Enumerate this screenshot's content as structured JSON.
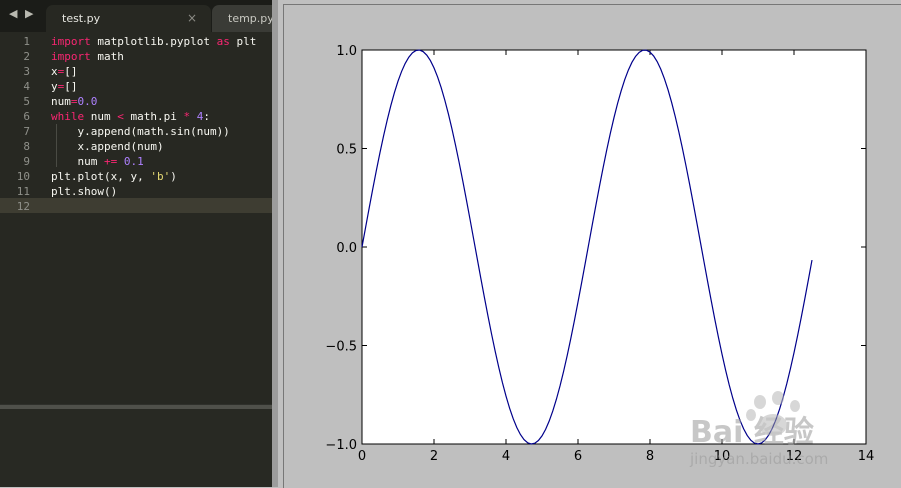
{
  "editor": {
    "tabs": [
      {
        "label": "test.py",
        "active": true,
        "close_glyph": "×"
      },
      {
        "label": "temp.py",
        "active": false
      }
    ],
    "nav_back_icon": "triangle-left-icon",
    "nav_forward_icon": "triangle-right-icon",
    "line_numbers": [
      "1",
      "2",
      "3",
      "4",
      "5",
      "6",
      "7",
      "8",
      "9",
      "10",
      "11",
      "12"
    ],
    "code_lines": [
      [
        {
          "t": "import",
          "c": "kw"
        },
        {
          "t": " matplotlib.pyplot ",
          "c": ""
        },
        {
          "t": "as",
          "c": "kw"
        },
        {
          "t": " plt",
          "c": ""
        }
      ],
      [
        {
          "t": "import",
          "c": "kw"
        },
        {
          "t": " math",
          "c": ""
        }
      ],
      [
        {
          "t": "x",
          "c": ""
        },
        {
          "t": "=",
          "c": "op"
        },
        {
          "t": "[]",
          "c": ""
        }
      ],
      [
        {
          "t": "y",
          "c": ""
        },
        {
          "t": "=",
          "c": "op"
        },
        {
          "t": "[]",
          "c": ""
        }
      ],
      [
        {
          "t": "num",
          "c": ""
        },
        {
          "t": "=",
          "c": "op"
        },
        {
          "t": "0.0",
          "c": "num"
        }
      ],
      [
        {
          "t": "while",
          "c": "kw"
        },
        {
          "t": " num ",
          "c": ""
        },
        {
          "t": "<",
          "c": "op"
        },
        {
          "t": " math.pi ",
          "c": ""
        },
        {
          "t": "*",
          "c": "op"
        },
        {
          "t": " ",
          "c": ""
        },
        {
          "t": "4",
          "c": "num"
        },
        {
          "t": ":",
          "c": ""
        }
      ],
      [
        {
          "t": "    y.append(math.sin(num))",
          "c": ""
        }
      ],
      [
        {
          "t": "    x.append(num)",
          "c": ""
        }
      ],
      [
        {
          "t": "    num ",
          "c": ""
        },
        {
          "t": "+=",
          "c": "op"
        },
        {
          "t": " ",
          "c": ""
        },
        {
          "t": "0.1",
          "c": "num"
        }
      ],
      [
        {
          "t": "plt.plot(x, y, ",
          "c": ""
        },
        {
          "t": "'b'",
          "c": "str"
        },
        {
          "t": ")",
          "c": ""
        }
      ],
      [
        {
          "t": "plt.show()",
          "c": ""
        }
      ],
      [
        {
          "t": "",
          "c": ""
        }
      ]
    ],
    "current_line": 12
  },
  "colors": {
    "line": "#00008b",
    "keyword": "#f92672",
    "number": "#ae81ff",
    "string": "#e6db74"
  },
  "chart_data": {
    "type": "line",
    "title": "",
    "xlabel": "",
    "ylabel": "",
    "xlim": [
      0,
      14
    ],
    "ylim": [
      -1.0,
      1.0
    ],
    "xticks": [
      "0",
      "2",
      "4",
      "6",
      "8",
      "10",
      "12",
      "14"
    ],
    "yticks": [
      "−1.0",
      "−0.5",
      "0.0",
      "0.5",
      "1.0"
    ],
    "grid": false,
    "series": [
      {
        "function": "y = sin(x)",
        "x_start": 0.0,
        "x_step": 0.1,
        "x_end": 12.5,
        "color": "#00008b"
      }
    ]
  },
  "watermark": {
    "text": "Bai 经验",
    "url": "jingyan.baidu.com"
  }
}
